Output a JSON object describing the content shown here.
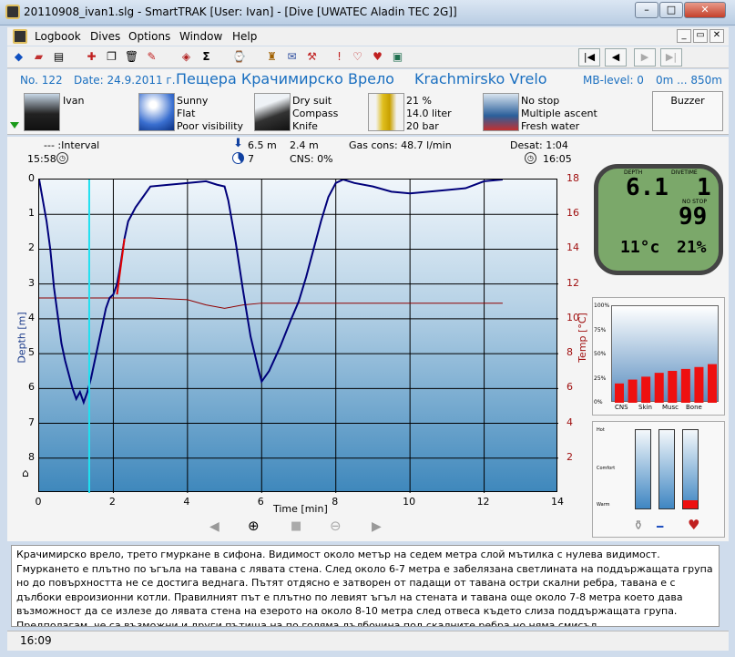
{
  "window": {
    "title": "20110908_ivan1.slg - SmartTRAK [User: Ivan] - [Dive  [UWATEC Aladin TEC 2G]]",
    "min": "–",
    "max": "□",
    "close": "✕"
  },
  "menu": [
    "Logbook",
    "Dives",
    "Options",
    "Window",
    "Help"
  ],
  "mdi": {
    "min": "_",
    "restore": "▭",
    "close": "✕"
  },
  "nav": {
    "first": "|◀",
    "prev": "◀",
    "next": "▶",
    "last": "▶|"
  },
  "dive": {
    "number": "No. 122",
    "date": "Date: 24.9.2011 г.",
    "site_bg": "Пещера Крачимирско Врело",
    "site_en": "Krachmirsko Vrelo",
    "mb_level": "MB-level: 0",
    "altitude": "0m ... 850m",
    "buddy": "Ivan",
    "weather": [
      "Sunny",
      "Flat",
      "Poor visibility"
    ],
    "equipment": [
      "Dry suit",
      "Compass",
      "Knife"
    ],
    "tank": [
      "21 %",
      "14.0 liter",
      "20 bar"
    ],
    "deco": [
      "No stop",
      "Multiple ascent",
      "Fresh water"
    ],
    "buzzer": "Buzzer"
  },
  "profile_header": {
    "interval_label": "--- :Interval",
    "start_time": "15:58",
    "max_depth": "6.5 m",
    "avg_depth": "2.4 m",
    "gas_cons": "Gas cons: 48.7 l/min",
    "dive_time": "7",
    "cns": "CNS: 0%",
    "desat": "Desat: 1:04",
    "end_time": "16:05"
  },
  "chart_data": {
    "type": "line",
    "xlabel": "Time [min]",
    "ylabel": "Depth [m]",
    "y2label": "Temp [°C]",
    "xlim": [
      0,
      14
    ],
    "ylim": [
      0,
      9
    ],
    "y2lim": [
      0,
      18
    ],
    "x_ticks": [
      "0",
      "2",
      "4",
      "6",
      "8",
      "10",
      "12",
      "14"
    ],
    "y_ticks": [
      "0",
      "1",
      "2",
      "3",
      "4",
      "5",
      "6",
      "7",
      "8"
    ],
    "y2_ticks": [
      "18",
      "16",
      "14",
      "12",
      "10",
      "8",
      "6",
      "4",
      "2"
    ],
    "grid": true,
    "series": [
      {
        "kind": "depth",
        "color": "#00007a",
        "x": [
          0,
          0.1,
          0.2,
          0.3,
          0.4,
          0.5,
          0.6,
          0.7,
          0.8,
          0.9,
          1.0,
          1.1,
          1.2,
          1.3,
          1.4,
          1.5,
          1.6,
          1.7,
          1.8,
          1.9,
          2.0,
          2.1,
          2.2,
          2.3,
          2.4,
          2.5,
          2.6,
          2.8,
          3.0,
          3.5,
          4.0,
          4.5,
          4.8,
          5.0,
          5.1,
          5.3,
          5.5,
          5.7,
          5.9,
          6.0,
          6.2,
          6.5,
          6.8,
          7.0,
          7.2,
          7.4,
          7.6,
          7.8,
          8.0,
          8.2,
          8.5,
          9.0,
          9.5,
          10.0,
          10.5,
          11.0,
          11.5,
          12.0,
          12.5
        ],
        "y": [
          0,
          0.6,
          1.2,
          2.0,
          3.1,
          3.9,
          4.7,
          5.2,
          5.6,
          6.0,
          6.3,
          6.1,
          6.4,
          6.1,
          5.7,
          5.2,
          4.7,
          4.2,
          3.7,
          3.4,
          3.3,
          3.0,
          2.4,
          1.7,
          1.2,
          1.0,
          0.8,
          0.5,
          0.2,
          0.15,
          0.1,
          0.05,
          0.15,
          0.2,
          0.6,
          1.8,
          3.2,
          4.5,
          5.4,
          5.8,
          5.5,
          4.8,
          4.0,
          3.5,
          2.8,
          2.0,
          1.2,
          0.5,
          0.1,
          0,
          0.1,
          0.2,
          0.35,
          0.4,
          0.35,
          0.3,
          0.25,
          0.05,
          0
        ]
      },
      {
        "kind": "temperature",
        "color": "#900000",
        "x": [
          0,
          2,
          3,
          4,
          4.5,
          5,
          5.5,
          6,
          8,
          10,
          12.5
        ],
        "y": [
          11.2,
          11.2,
          11.2,
          11.1,
          10.8,
          10.6,
          10.8,
          10.9,
          10.9,
          10.9,
          10.9
        ]
      }
    ],
    "ascent_warning": {
      "color": "#e00000",
      "x": [
        2.1,
        2.3
      ],
      "y": [
        3.3,
        1.7
      ]
    },
    "cursor_x": 1.35
  },
  "computer_display": {
    "depth_label": "DEPTH",
    "divetime_label": "DIVETIME",
    "depth": "6.1",
    "divetime": "1",
    "nostop_label": "NO STOP",
    "nostop": "99",
    "temp": "11°c",
    "o2": "21%"
  },
  "tissue_chart": {
    "type": "bar",
    "categories": [
      "CNS",
      "Skin",
      "Musc",
      "Bone"
    ],
    "y_ticks": [
      "100%",
      "75%",
      "50%",
      "25%",
      "0%"
    ],
    "values": [
      20,
      24,
      27,
      31,
      33,
      35,
      37,
      40
    ]
  },
  "gauges": {
    "labels": [
      "Hot",
      "Comfort",
      "Warm"
    ],
    "levels": [
      0,
      0,
      0.11
    ]
  },
  "notes": "Крачимирско врело, трето гмуркане в сифона. Видимост около метър на седем метра слой мътилка с нулева видимост. Гмуркането е плътно по ъгъла на тавана с лявата стена. След около 6-7 метра е забелязана светлината на поддържащата група но до повърхността не се достига веднага. Пътят отдясно е затворен от падащи от тавана остри скални ребра, тавана е с дълбоки евроизионни котли. Правилният път е плътно по левият ъгъл на стената и тавана още около 7-8 метра което дава възможност да се излезе до лявата стена на езерото на около 8-10 метра след отвеса където слиза поддържащата група. Предполагам ,че са възможни и други пътища на по голяма дълбочина под скалните ребра но няма смисъл.",
  "status": {
    "time": "16:09"
  }
}
